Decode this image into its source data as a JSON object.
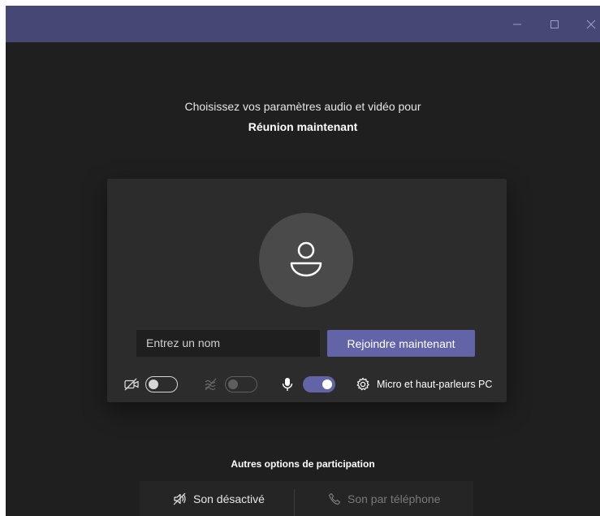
{
  "window": {
    "controls": {
      "minimize_icon": "minimize-icon",
      "maximize_icon": "maximize-icon",
      "close_icon": "close-icon"
    }
  },
  "heading": {
    "line1": "Choisissez vos paramètres audio et vidéo pour",
    "meeting_name": "Réunion maintenant"
  },
  "prejoin": {
    "name_input": {
      "value": "",
      "placeholder": "Entrez un nom"
    },
    "join_label": "Rejoindre maintenant",
    "controls": {
      "camera": {
        "icon": "camera-off-icon",
        "on": false
      },
      "background_blur": {
        "icon": "blur-icon",
        "on": false,
        "disabled": true
      },
      "microphone": {
        "icon": "microphone-icon",
        "on": true
      },
      "device_settings": {
        "icon": "gear-icon",
        "label": "Micro et haut-parleurs PC"
      }
    }
  },
  "other_options": {
    "title": "Autres options de participation",
    "audio_off": {
      "icon": "speaker-off-icon",
      "label": "Son désactivé"
    },
    "phone_audio": {
      "icon": "phone-icon",
      "label": "Son par téléphone"
    }
  },
  "colors": {
    "titlebar": "#464775",
    "background": "#1f1f1f",
    "card": "#2d2c2c",
    "accent": "#6264a7"
  }
}
